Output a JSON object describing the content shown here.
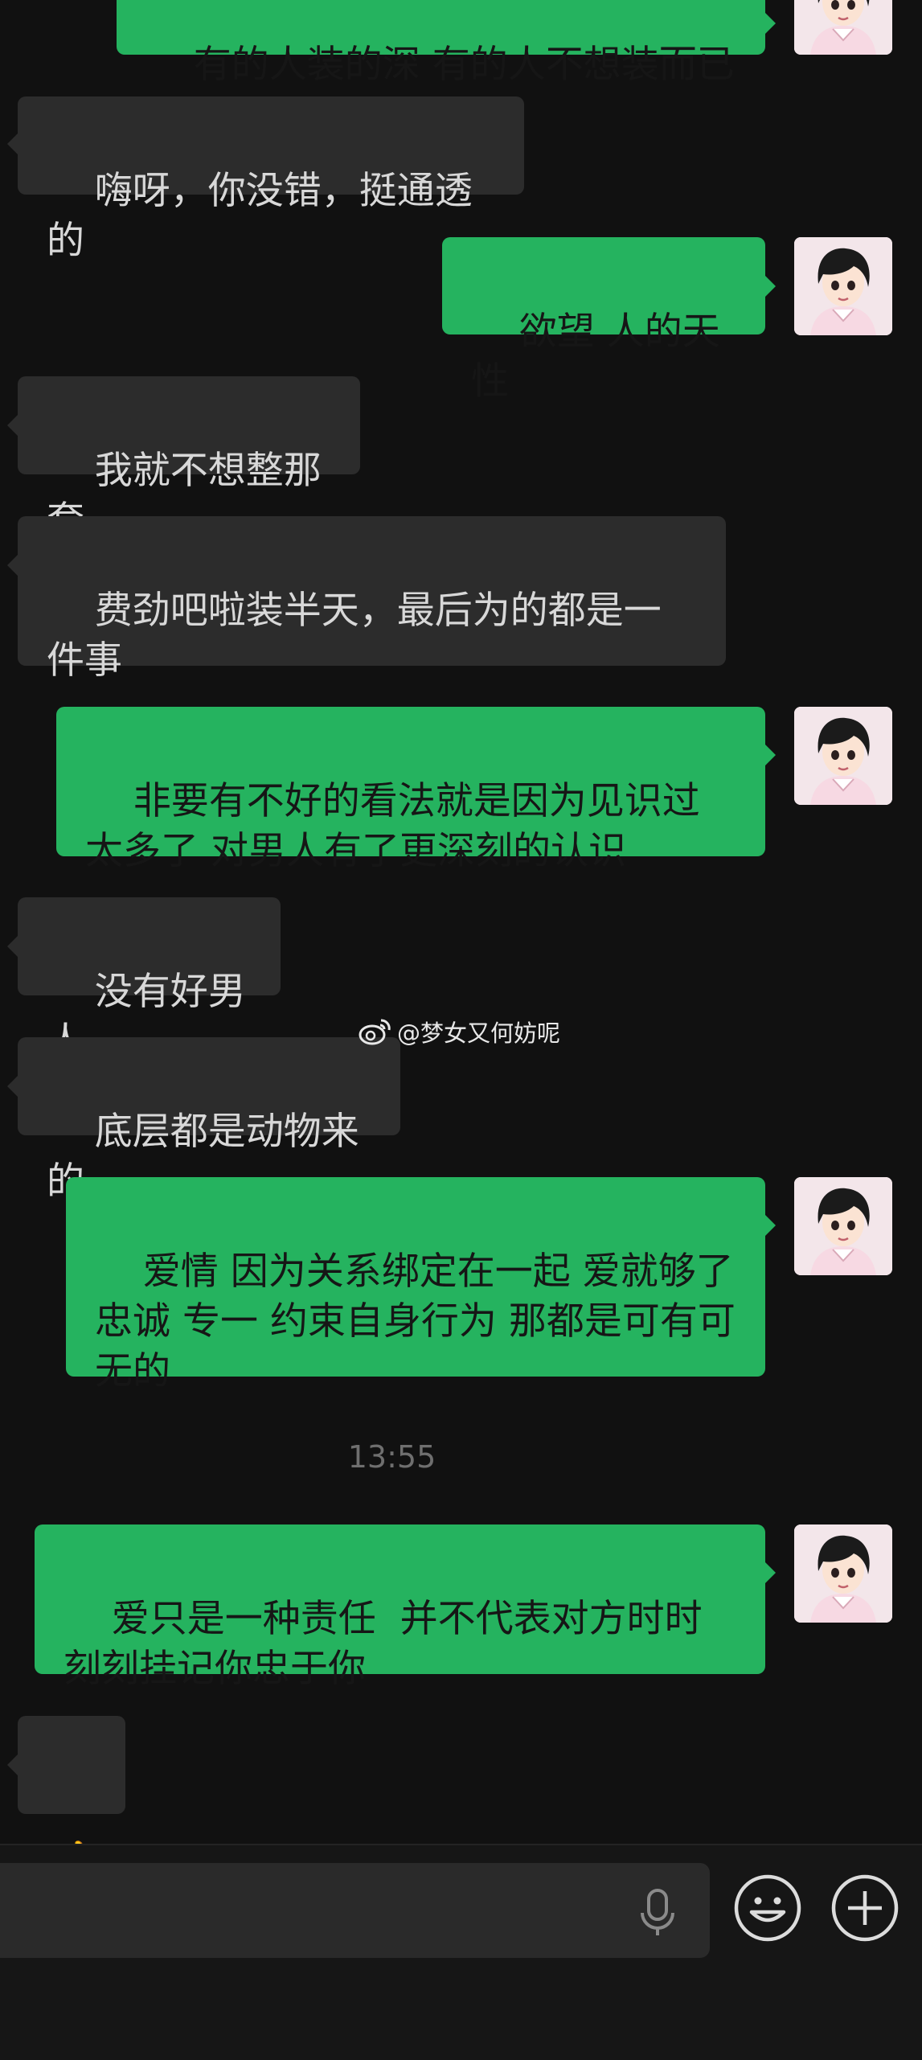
{
  "messages": [
    {
      "side": "out",
      "text": "有的人装的深 有的人不想装而已"
    },
    {
      "side": "in",
      "text": "嗨呀，你没错，挺通透的"
    },
    {
      "side": "out",
      "text": "欲望 人的天性"
    },
    {
      "side": "in",
      "text": "我就不想整那套"
    },
    {
      "side": "in",
      "text": "费劲吧啦装半天，最后为的都是一件事"
    },
    {
      "side": "out",
      "text": "非要有不好的看法就是因为见识过太多了 对男人有了更深刻的认识"
    },
    {
      "side": "in",
      "text": "没有好男人"
    },
    {
      "side": "in",
      "text": "底层都是动物来的"
    },
    {
      "side": "out",
      "text": "爱情 因为关系绑定在一起 爱就够了 忠诚 专一 约束自身行为 那都是可有可无的"
    },
    {
      "side": "out",
      "text": "爱只是一种责任  并不代表对方时时刻刻挂记你忠于你"
    },
    {
      "side": "in",
      "text": "👍"
    }
  ],
  "timestamp": "13:55",
  "watermark": {
    "text": "@梦女又何妨呢",
    "icon": "weibo-icon"
  },
  "input_bar": {
    "placeholder": "",
    "icons": [
      "microphone-icon",
      "emoji-icon",
      "plus-icon"
    ]
  },
  "colors": {
    "background": "#111111",
    "bubble_out": "#25b35f",
    "bubble_in": "#2c2c2c",
    "text_in": "#d8d8d8",
    "text_out": "#161616",
    "timestamp": "#6f6f6f"
  }
}
